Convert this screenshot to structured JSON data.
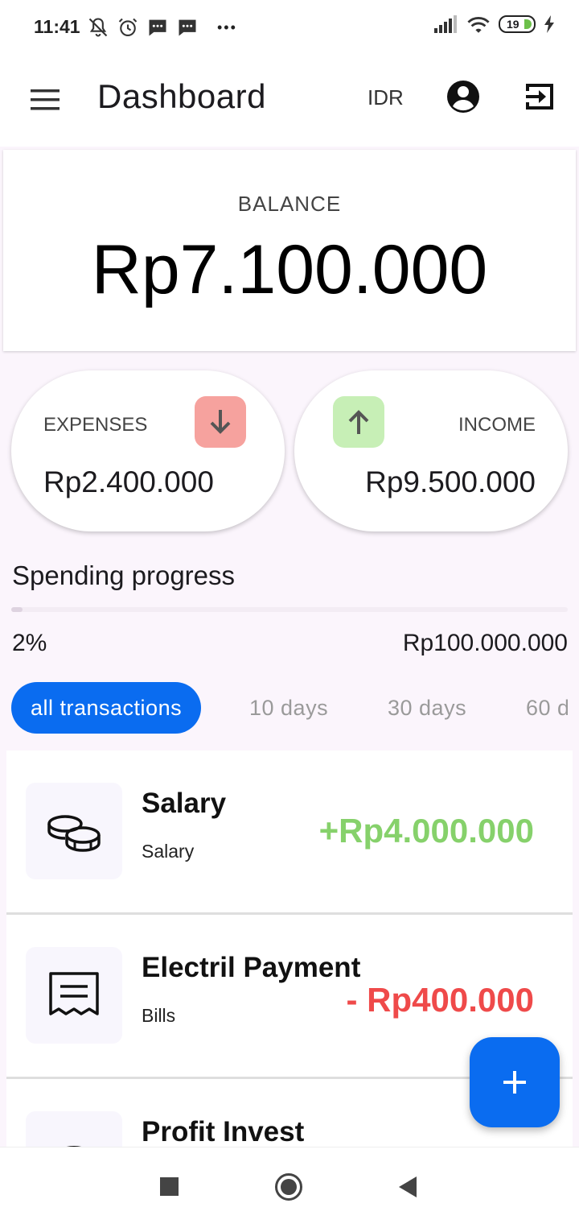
{
  "status_bar": {
    "time": "11:41",
    "battery": "19",
    "more": "•••"
  },
  "app_bar": {
    "title": "Dashboard",
    "currency": "IDR",
    "icons": [
      "menu-icon",
      "account-circle-icon",
      "logout-icon"
    ]
  },
  "balance": {
    "label": "BALANCE",
    "value": "Rp7.100.000"
  },
  "expenses": {
    "label": "EXPENSES",
    "value": "Rp2.400.000",
    "icon": "arrow-down-icon",
    "color": "#f6a29e"
  },
  "income": {
    "label": "INCOME",
    "value": "Rp9.500.000",
    "icon": "arrow-up-icon",
    "color": "#c7efb6"
  },
  "spending": {
    "title": "Spending progress",
    "percent_label": "2%",
    "progress_fraction": 0.02,
    "target": "Rp100.000.000"
  },
  "filters": [
    {
      "label": "all transactions",
      "active": true
    },
    {
      "label": "10 days",
      "active": false
    },
    {
      "label": "30 days",
      "active": false
    },
    {
      "label": "60 d",
      "active": false
    }
  ],
  "transactions": [
    {
      "name": "Salary",
      "category": "Salary",
      "amount": "+Rp4.000.000",
      "type": "income",
      "icon": "coins-icon"
    },
    {
      "name": "Electril Payment",
      "category": "Bills",
      "amount": "- Rp400.000",
      "type": "expense",
      "icon": "receipt-icon"
    },
    {
      "name": "Profit Invest",
      "category": "",
      "amount": "",
      "type": "income",
      "icon": "coins-icon"
    }
  ],
  "colors": {
    "accent": "#0a6cf0",
    "income_text": "#86d16b",
    "expense_text": "#ef4a4a",
    "background": "#fbf5fc"
  }
}
